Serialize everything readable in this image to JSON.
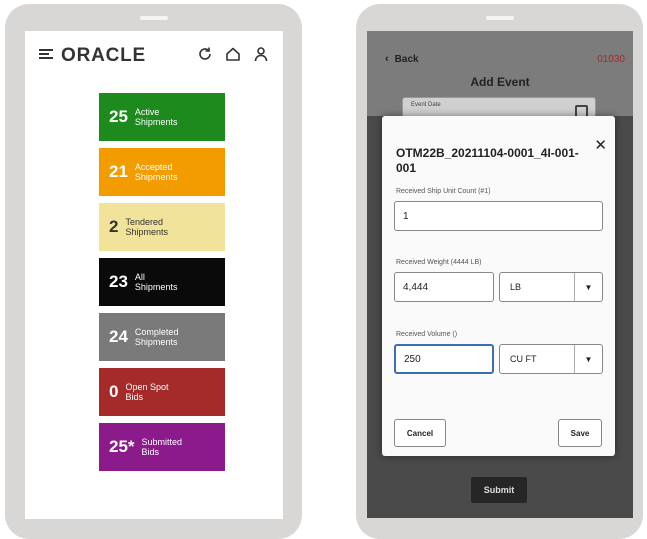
{
  "left": {
    "header": {
      "logo": "ORACLE",
      "icons": [
        "menu-icon",
        "refresh-icon",
        "home-icon",
        "user-icon"
      ]
    },
    "tiles": [
      {
        "count": "25",
        "label": "Active\nShipments",
        "color": "#1c8a1c"
      },
      {
        "count": "21",
        "label": "Accepted\nShipments",
        "color": "#f29c00"
      },
      {
        "count": "2",
        "label": "Tendered\nShipments",
        "color": "#f1e39a"
      },
      {
        "count": "23",
        "label": "All\nShipments",
        "color": "#0a0a0a"
      },
      {
        "count": "24",
        "label": "Completed\nShipments",
        "color": "#7a7a7a"
      },
      {
        "count": "0",
        "label": "Open Spot\nBids",
        "color": "#a52a2a"
      },
      {
        "count": "25*",
        "label": "Submitted\nBids",
        "color": "#8b1a8b"
      }
    ]
  },
  "right": {
    "back_label": "Back",
    "code": "01030",
    "title": "Add Event",
    "event_date": {
      "label": "Event Date"
    },
    "submit_label": "Submit",
    "modal": {
      "title": "OTM22B_20211104-0001_4I-001-001",
      "ship_unit_label": "Received Ship Unit Count (#1)",
      "ship_unit_value": "1",
      "weight_label": "Received Weight (4444 LB)",
      "weight_value": "4,444",
      "weight_unit": "LB",
      "volume_label": "Received Volume ()",
      "volume_value": "250",
      "volume_unit": "CU FT",
      "cancel_label": "Cancel",
      "save_label": "Save"
    }
  }
}
